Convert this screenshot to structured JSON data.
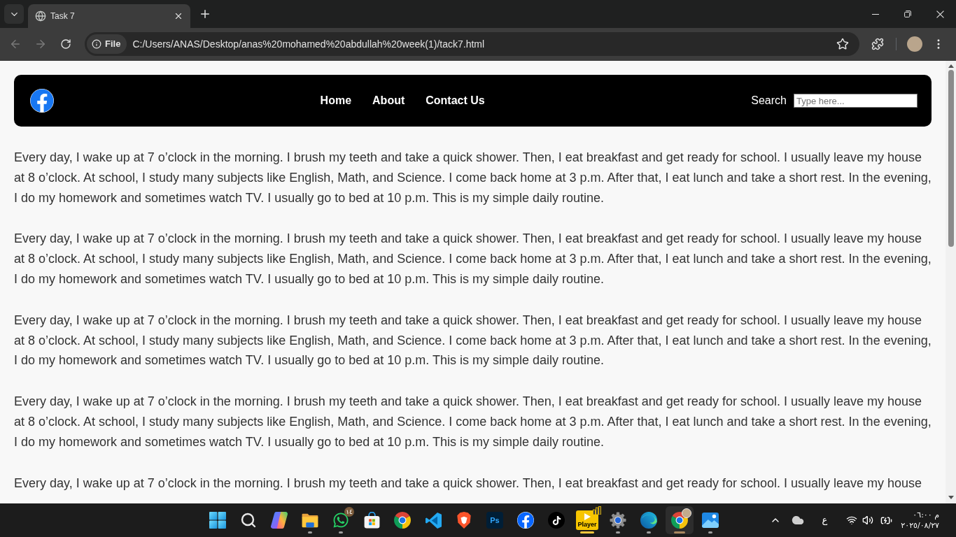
{
  "browser": {
    "tabs": [
      {
        "title": "Task 7",
        "selected": true
      }
    ],
    "toolbar": {
      "buttons": [
        {
          "kind": "back",
          "disabled": true
        },
        {
          "kind": "forward",
          "disabled": true
        },
        {
          "kind": "reload",
          "disabled": false
        }
      ],
      "address": {
        "chip": "File",
        "url": "C:/Users/ANAS/Desktop/anas%20mohamed%20abdullah%20week(1)/tack7.html"
      }
    }
  },
  "page": {
    "navbar": {
      "links": [
        "Home",
        "About",
        "Contact Us"
      ],
      "search": {
        "label": "Search",
        "placeholder": "Type here..."
      }
    },
    "paragraphs": [
      "Every day, I wake up at 7 o’clock in the morning. I brush my teeth and take a quick shower. Then, I eat breakfast and get ready for school. I usually leave my house at 8 o’clock. At school, I study many subjects like English, Math, and Science. I come back home at 3 p.m. After that, I eat lunch and take a short rest. In the evening, I do my homework and sometimes watch TV. I usually go to bed at 10 p.m. This is my simple daily routine.",
      "Every day, I wake up at 7 o’clock in the morning. I brush my teeth and take a quick shower. Then, I eat breakfast and get ready for school. I usually leave my house at 8 o’clock. At school, I study many subjects like English, Math, and Science. I come back home at 3 p.m. After that, I eat lunch and take a short rest. In the evening, I do my homework and sometimes watch TV. I usually go to bed at 10 p.m. This is my simple daily routine.",
      "Every day, I wake up at 7 o’clock in the morning. I brush my teeth and take a quick shower. Then, I eat breakfast and get ready for school. I usually leave my house at 8 o’clock. At school, I study many subjects like English, Math, and Science. I come back home at 3 p.m. After that, I eat lunch and take a short rest. In the evening, I do my homework and sometimes watch TV. I usually go to bed at 10 p.m. This is my simple daily routine.",
      "Every day, I wake up at 7 o’clock in the morning. I brush my teeth and take a quick shower. Then, I eat breakfast and get ready for school. I usually leave my house at 8 o’clock. At school, I study many subjects like English, Math, and Science. I come back home at 3 p.m. After that, I eat lunch and take a short rest. In the evening, I do my homework and sometimes watch TV. I usually go to bed at 10 p.m. This is my simple daily routine.",
      "Every day, I wake up at 7 o’clock in the morning. I brush my teeth and take a quick shower. Then, I eat breakfast and get ready for school. I usually leave my house"
    ]
  },
  "taskbar": {
    "apps": [
      {
        "kind": "start",
        "running": false,
        "selected": false,
        "attention": false
      },
      {
        "kind": "search",
        "running": false,
        "selected": false,
        "attention": false
      },
      {
        "kind": "copilot",
        "running": false,
        "selected": false,
        "attention": false
      },
      {
        "kind": "explorer",
        "running": true,
        "selected": false,
        "attention": false
      },
      {
        "kind": "whatsapp",
        "running": true,
        "selected": false,
        "attention": false,
        "badge": "١٤"
      },
      {
        "kind": "store",
        "running": false,
        "selected": false,
        "attention": false
      },
      {
        "kind": "chrome",
        "running": false,
        "selected": false,
        "attention": false
      },
      {
        "kind": "vscode",
        "running": false,
        "selected": false,
        "attention": false
      },
      {
        "kind": "brave",
        "running": false,
        "selected": false,
        "attention": false
      },
      {
        "kind": "photoshop",
        "running": false,
        "selected": false,
        "attention": false,
        "text": "Ps"
      },
      {
        "kind": "facebook",
        "running": false,
        "selected": false,
        "attention": false
      },
      {
        "kind": "tiktok",
        "running": false,
        "selected": false,
        "attention": false
      },
      {
        "kind": "player",
        "running": true,
        "selected": false,
        "attention": true,
        "text": "Player"
      },
      {
        "kind": "settings",
        "running": true,
        "selected": false,
        "attention": false
      },
      {
        "kind": "edge",
        "running": true,
        "selected": false,
        "attention": false
      },
      {
        "kind": "chrome_profile",
        "running": true,
        "selected": true,
        "attention": false
      },
      {
        "kind": "photos",
        "running": true,
        "selected": false,
        "attention": false
      }
    ],
    "tray": {
      "language": "ع",
      "time": "م ٠٦:٠٠",
      "date": "٢٠٢٥/٠٨/٢٧"
    }
  }
}
